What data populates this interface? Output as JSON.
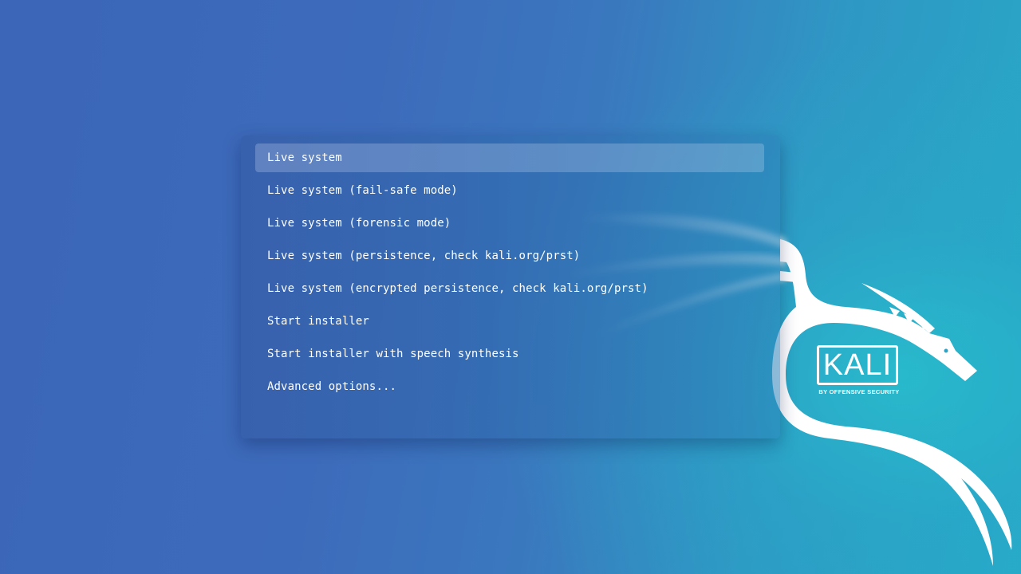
{
  "boot_menu": {
    "selected_index": 0,
    "items": [
      {
        "label": "Live system"
      },
      {
        "label": "Live system (fail-safe mode)"
      },
      {
        "label": "Live system (forensic mode)"
      },
      {
        "label": "Live system (persistence, check kali.org/prst)"
      },
      {
        "label": "Live system (encrypted persistence, check kali.org/prst)"
      },
      {
        "label": "Start installer"
      },
      {
        "label": "Start installer with speech synthesis"
      },
      {
        "label": "Advanced options..."
      }
    ]
  },
  "branding": {
    "logo_text": "KALI",
    "logo_subtext": "BY OFFENSIVE SECURITY",
    "mascot_icon": "kali-dragon-icon"
  },
  "colors": {
    "background_left": "#3c66b8",
    "background_right": "#27aac8",
    "text": "#ffffff",
    "selection": "rgba(200,215,240,0.28)"
  }
}
